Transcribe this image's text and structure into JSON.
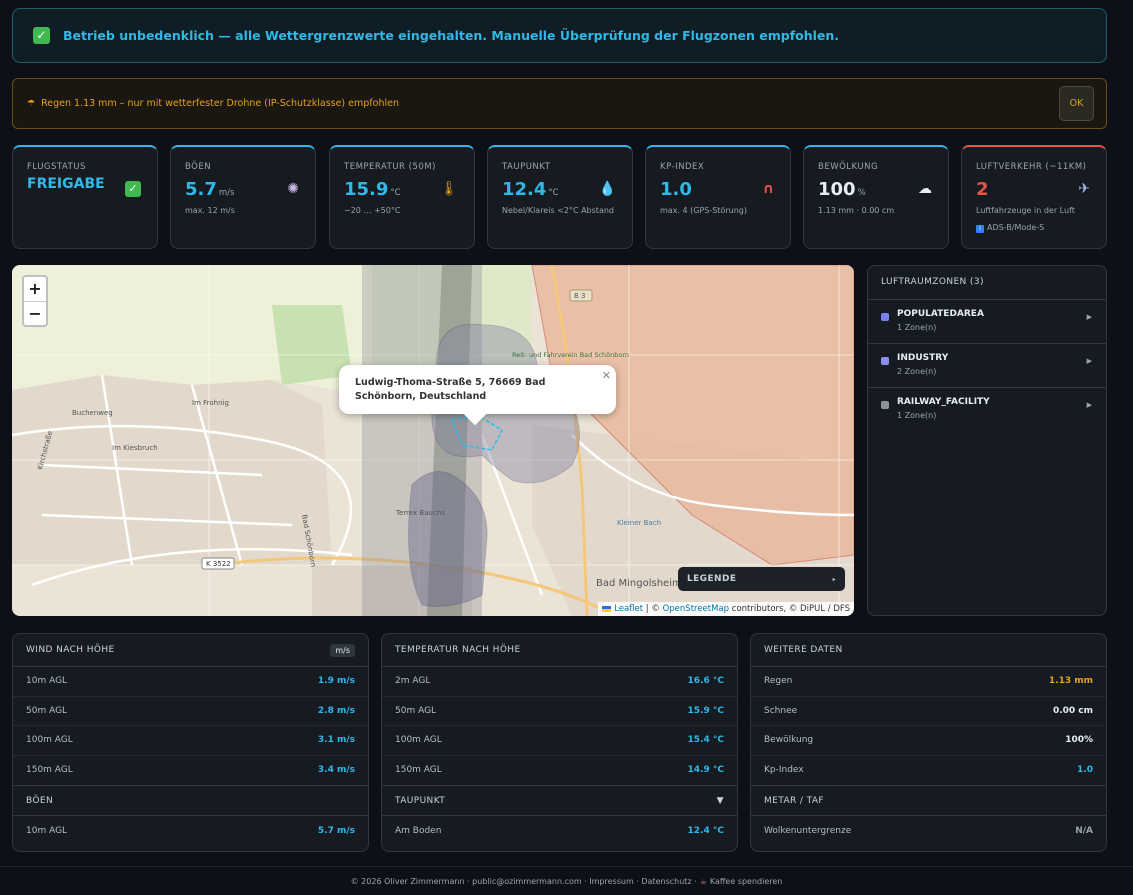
{
  "banner": {
    "text": "Betrieb unbedenklich — alle Wettergrenzwerte eingehalten. Manuelle Überprüfung der Flugzonen empfohlen.",
    "icon": "check-icon"
  },
  "rain_warning": {
    "text": "Regen 1.13 mm – nur mit wetterfester Drohne (IP-Schutzklasse) empfohlen",
    "icon": "umbrella-icon",
    "button": "OK"
  },
  "cards": {
    "flight": {
      "label": "FLUGSTATUS",
      "value": "FREIGABE"
    },
    "gusts": {
      "label": "BÖEN",
      "value": "5.7",
      "unit": "m/s",
      "sub": "max. 12 m/s"
    },
    "temp": {
      "label": "TEMPERATUR (50M)",
      "value": "15.9",
      "unit": "°C",
      "sub": "−20 … +50°C"
    },
    "dew": {
      "label": "TAUPUNKT",
      "value": "12.4",
      "unit": "°C",
      "sub": "Nebel/Klareis <2°C Abstand"
    },
    "kp": {
      "label": "KP-INDEX",
      "value": "1.0",
      "sub": "max. 4 (GPS-Störung)"
    },
    "clouds": {
      "label": "BEWÖLKUNG",
      "value": "100",
      "unit": "%",
      "sub": "1.13 mm · 0.00 cm"
    },
    "traffic": {
      "label": "LUFTVERKEHR (~11KM)",
      "value": "2",
      "sub": "Luftfahrzeuge in der Luft",
      "sub2": "ADS-B/Mode-S"
    }
  },
  "map": {
    "popup": "Ludwig-Thoma-Straße 5, 76669 Bad Schönborn, Deutschland",
    "legend": "LEGENDE",
    "zoom_in": "+",
    "zoom_out": "−",
    "attribution_leaflet": "Leaflet",
    "attribution_sep": " | © ",
    "attribution_osm": "OpenStreetMap",
    "attribution_rest": " contributors, © DiPUL / DFS",
    "labels": {
      "buchenweg": "Buchenweg",
      "kirchstrasse": "Kirchstraße",
      "im_kiesbruch": "Im Kiesbruch",
      "im_frohnig": "Im Frohnig",
      "terrex": "Terrex Bauchs",
      "b3": "B 3",
      "k3522": "K 3522",
      "bad_mingolsheim": "Bad Mingolsheim",
      "bad_schoenborn": "Bad Schönborn",
      "reitverein": "Reit- und Fahrverein Bad Schönborn",
      "kleiner_bach": "Kleiner Bach"
    }
  },
  "zones": {
    "title": "LUFTRAUMZONEN (3)",
    "items": [
      {
        "name": "POPULATEDAREA",
        "count": "1 Zone(n)",
        "color": "#7b7ff5"
      },
      {
        "name": "INDUSTRY",
        "count": "2 Zone(n)",
        "color": "#8a8ef5"
      },
      {
        "name": "RAILWAY_FACILITY",
        "count": "1 Zone(n)",
        "color": "#8b949e"
      }
    ]
  },
  "wind": {
    "title": "WIND NACH HÖHE",
    "unit_tag": "m/s",
    "rows": [
      {
        "k": "10m AGL",
        "v": "1.9 m/s"
      },
      {
        "k": "50m AGL",
        "v": "2.8 m/s"
      },
      {
        "k": "100m AGL",
        "v": "3.1 m/s"
      },
      {
        "k": "150m AGL",
        "v": "3.4 m/s"
      }
    ],
    "gust_title": "BÖEN",
    "gust_row": {
      "k": "10m AGL",
      "v": "5.7 m/s"
    }
  },
  "temperature": {
    "title": "TEMPERATUR NACH HÖHE",
    "rows": [
      {
        "k": "2m AGL",
        "v": "16.6 °C"
      },
      {
        "k": "50m AGL",
        "v": "15.9 °C"
      },
      {
        "k": "100m AGL",
        "v": "15.4 °C"
      },
      {
        "k": "150m AGL",
        "v": "14.9 °C"
      }
    ],
    "dew_title": "TAUPUNKT",
    "dew_row": {
      "k": "Am Boden",
      "v": "12.4 °C"
    }
  },
  "more": {
    "title": "WEITERE DATEN",
    "rows": [
      {
        "k": "Regen",
        "v": "1.13 mm"
      },
      {
        "k": "Schnee",
        "v": "0.00 cm"
      },
      {
        "k": "Bewölkung",
        "v": "100%"
      },
      {
        "k": "Kp-Index",
        "v": "1.0"
      }
    ],
    "metar_title": "METAR / TAF",
    "metar_row": {
      "k": "Wolkenuntergrenze",
      "v": "N/A"
    }
  },
  "footer": {
    "text": "© 2026 Oliver Zimmermann · public@ozimmermann.com · Impressum · Datenschutz · ",
    "coffee": "Kaffee spendieren"
  },
  "colors": {
    "accent": "#2fb8e8",
    "success": "#3fb950",
    "warning": "#e3a21a",
    "danger": "#e5534b"
  }
}
